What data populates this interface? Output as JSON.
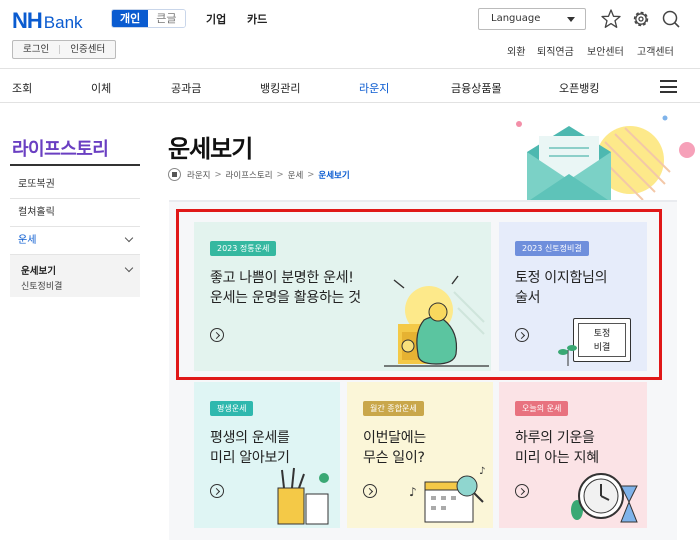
{
  "header": {
    "logo_nh": "NH",
    "logo_bank": "Bank",
    "segments": [
      "개인",
      "큰글"
    ],
    "top_nav": [
      "기업",
      "카드"
    ],
    "language_label": "Language",
    "auth_buttons": [
      "로그인",
      "인증센터"
    ],
    "util_links": [
      "외환",
      "퇴직연금",
      "보안센터",
      "고객센터"
    ]
  },
  "gnb": {
    "items": [
      "조회",
      "이체",
      "공과금",
      "뱅킹관리",
      "라운지",
      "금융상품몰",
      "오픈뱅킹"
    ],
    "active": "라운지"
  },
  "lnb": {
    "title": "라이프스토리",
    "items": [
      "로또복권",
      "컬쳐홀릭",
      "운세"
    ],
    "sub_active": "운세보기",
    "sub_other": "신토정비결"
  },
  "page": {
    "title": "운세보기",
    "breadcrumb": [
      "라운지",
      "라이프스토리",
      "운세",
      "운세보기"
    ]
  },
  "cards": [
    {
      "badge": "2023 정통운세",
      "line1": "좋고 나쁨이 분명한 운세!",
      "line2": "운세는 운명을 활용하는 것",
      "bg": "#e3f3ee",
      "badge_color": "#35b8a0"
    },
    {
      "badge": "2023 신토정비결",
      "line1": "토정 이지함님의",
      "line2": "술서",
      "bg": "#e6ecfa",
      "badge_color": "#6f8fdc",
      "book_label_1": "토정",
      "book_label_2": "비결"
    },
    {
      "badge": "평생운세",
      "line1": "평생의 운세를",
      "line2": "미리 알아보기",
      "bg": "#dff5f4",
      "badge_color": "#2fb8ae"
    },
    {
      "badge": "월간 종합운세",
      "line1": "이번달에는",
      "line2": "무슨 일이?",
      "bg": "#fbf6d8",
      "badge_color": "#c9a74a"
    },
    {
      "badge": "오늘의 운세",
      "line1": "하루의 기운을",
      "line2": "미리 아는 지혜",
      "bg": "#fbe3e6",
      "badge_color": "#e8727f"
    }
  ],
  "colors": {
    "brand": "#0a5bd0",
    "lnb_title": "#6a3fc2",
    "highlight_box": "#e01818"
  }
}
